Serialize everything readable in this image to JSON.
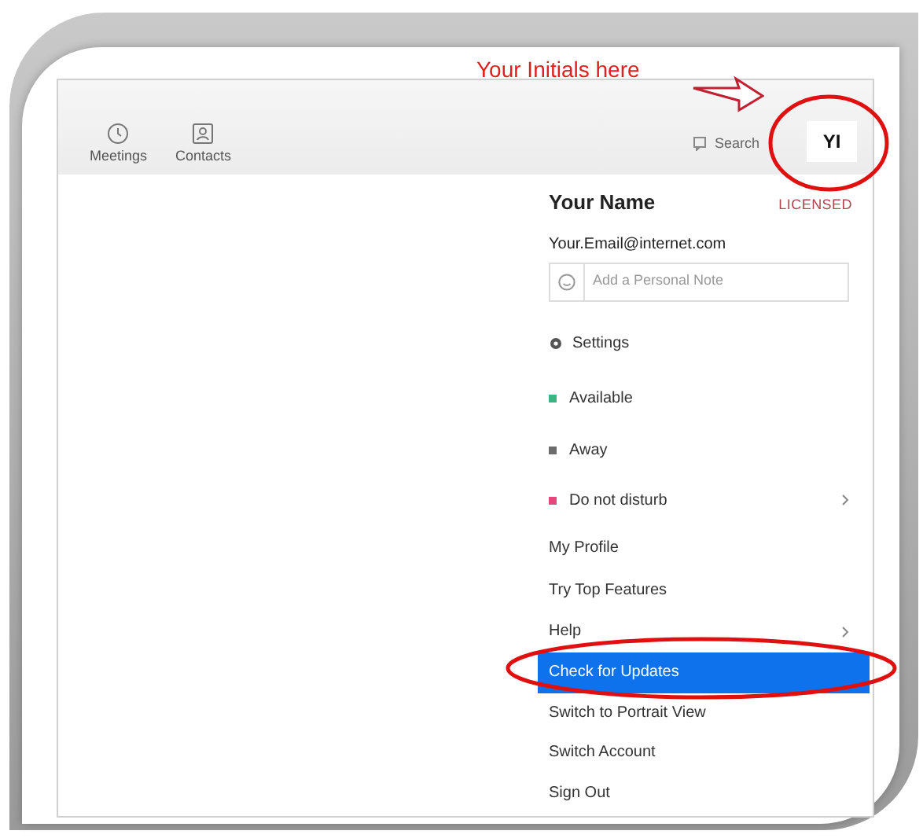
{
  "annotation": {
    "label": "Your Initials here"
  },
  "toolbar": {
    "tabs": [
      {
        "label": "Meetings",
        "kind": "clock"
      },
      {
        "label": "Contacts",
        "kind": "person"
      }
    ],
    "search": {
      "placeholder": "Search"
    },
    "avatar": {
      "initials": "YI"
    }
  },
  "menu": {
    "name": "Your Name",
    "badge": "LICENSED",
    "email": "Your.Email@internet.com",
    "note": {
      "placeholder": "Add a Personal Note"
    },
    "items": [
      {
        "kind": "settings",
        "label": "Settings",
        "selected": false,
        "submenu": false
      },
      {
        "kind": "status",
        "label": "Available",
        "color": "#3db383",
        "selected": false,
        "submenu": false
      },
      {
        "kind": "status",
        "label": "Away",
        "color": "#6b6b6b",
        "selected": false,
        "submenu": false
      },
      {
        "kind": "status",
        "label": "Do not disturb",
        "color": "#e5467c",
        "selected": false,
        "submenu": true
      },
      {
        "kind": "plain",
        "label": "My Profile",
        "selected": false,
        "submenu": false
      },
      {
        "kind": "plain",
        "label": "Try Top Features",
        "selected": false,
        "submenu": false
      },
      {
        "kind": "plain",
        "label": "Help",
        "selected": false,
        "submenu": true
      },
      {
        "kind": "plain",
        "label": "Check for Updates",
        "selected": true,
        "submenu": false
      },
      {
        "kind": "plain",
        "label": "Switch to Portrait View",
        "selected": false,
        "submenu": false
      },
      {
        "kind": "plain",
        "label": "Switch Account",
        "selected": false,
        "submenu": false
      },
      {
        "kind": "plain",
        "label": "Sign Out",
        "selected": false,
        "submenu": false
      }
    ]
  }
}
